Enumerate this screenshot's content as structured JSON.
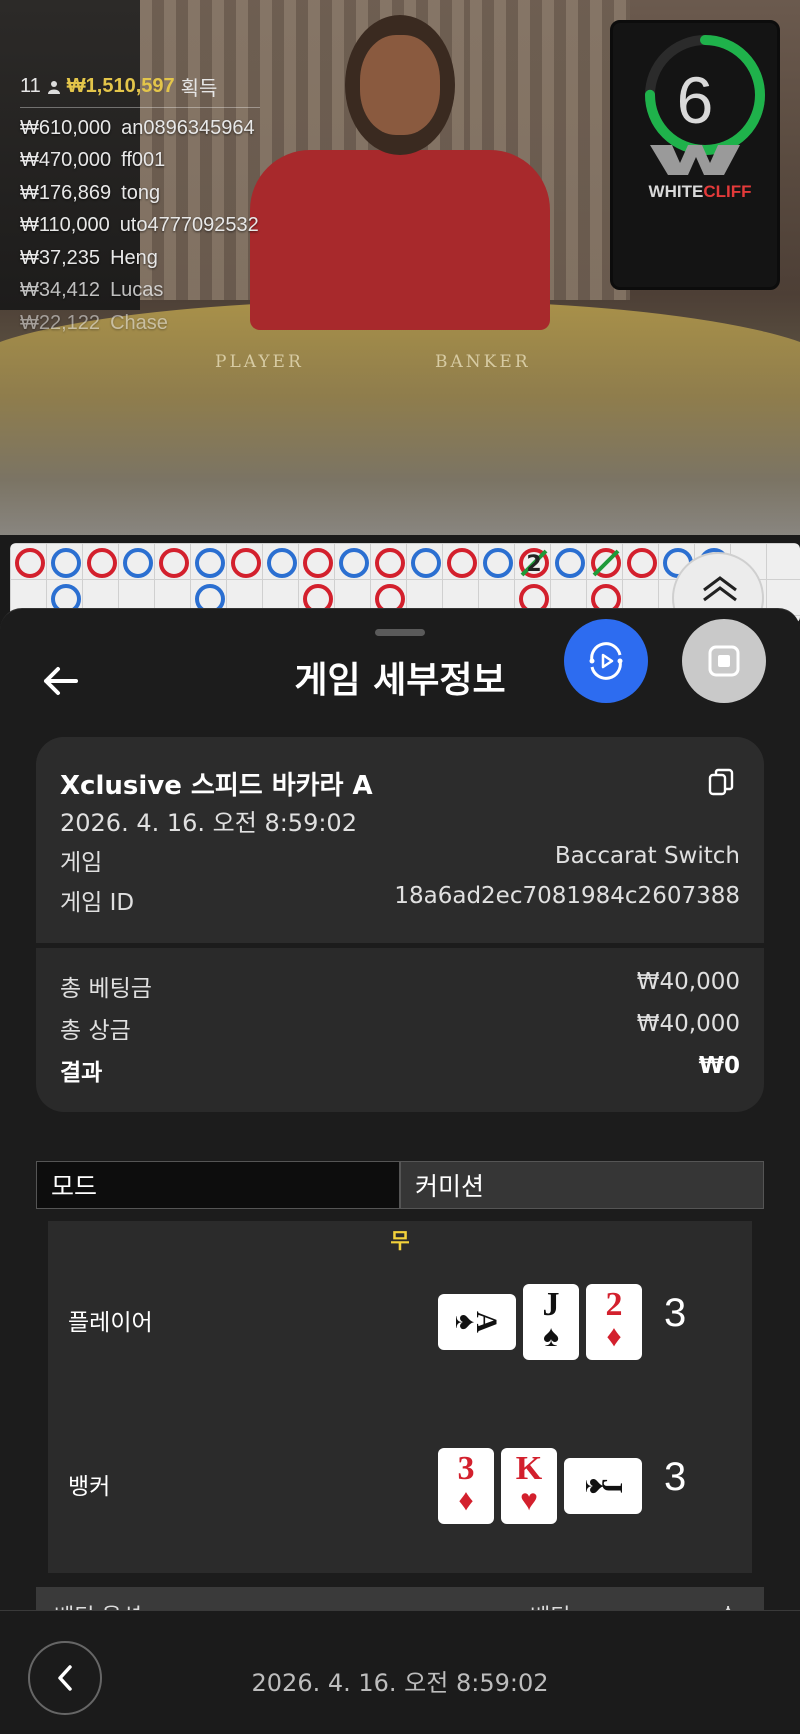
{
  "video": {
    "table_labels": {
      "player": "PLAYER",
      "banker": "BANKER"
    },
    "timer": {
      "seconds": "6",
      "progress": 0.75,
      "color": "#1fb24b"
    },
    "provider_logo": {
      "white": "WHITE",
      "red": "CLIFF"
    },
    "leaderboard": {
      "winners_count": "11",
      "total": "₩1,510,597",
      "total_suffix": "획득",
      "rows": [
        {
          "amount": "₩610,000",
          "user": "an0896345964"
        },
        {
          "amount": "₩470,000",
          "user": "ff001"
        },
        {
          "amount": "₩176,869",
          "user": "tong"
        },
        {
          "amount": "₩110,000",
          "user": "uto4777092532"
        },
        {
          "amount": "₩37,235",
          "user": "Heng"
        },
        {
          "amount": "₩34,412",
          "user": "Lucas"
        },
        {
          "amount": "₩22,122",
          "user": "Chase"
        }
      ]
    }
  },
  "roadmap": {
    "colors": {
      "player": "#2b6fd1",
      "banker": "#d3202d",
      "tie": "#1f9a3a"
    },
    "tie_count_label": "2"
  },
  "sheet": {
    "title": "게임 세부정보",
    "icons": {
      "back": "arrow-left-icon",
      "replay": "replay-icon",
      "stop": "stop-icon",
      "copy": "copy-icon"
    },
    "game": {
      "name": "Xclusive 스피드 바카라 A",
      "datetime": "2026. 4. 16. 오전 8:59:02",
      "type_label": "게임",
      "type_value": "Baccarat Switch",
      "id_label": "게임 ID",
      "id_value": "18a6ad2ec7081984c2607388"
    },
    "totals": {
      "bet_label": "총 베팅금",
      "bet_value": "₩40,000",
      "payout_label": "총 상금",
      "payout_value": "₩40,000",
      "result_label": "결과",
      "result_value": "₩0"
    },
    "tabs": {
      "mode": "모드",
      "commission": "커미션"
    },
    "outcome": "무",
    "player": {
      "label": "플레이어",
      "score": "3",
      "cards": [
        {
          "rank": "A",
          "suit": "♠",
          "color": "black",
          "orientation": "horizontal"
        },
        {
          "rank": "J",
          "suit": "♠",
          "color": "black",
          "orientation": "vertical"
        },
        {
          "rank": "2",
          "suit": "♦",
          "color": "red",
          "orientation": "vertical"
        }
      ]
    },
    "banker": {
      "label": "뱅커",
      "score": "3",
      "cards": [
        {
          "rank": "3",
          "suit": "♦",
          "color": "red",
          "orientation": "vertical"
        },
        {
          "rank": "K",
          "suit": "♥",
          "color": "red",
          "orientation": "vertical"
        },
        {
          "rank": "J",
          "suit": "♠",
          "color": "black",
          "orientation": "horizontal"
        }
      ]
    },
    "bet_table_header": {
      "option": "베팅 옵션",
      "bet": "베팅",
      "net": "순"
    }
  },
  "footer": {
    "datetime": "2026. 4. 16. 오전 8:59:02"
  }
}
